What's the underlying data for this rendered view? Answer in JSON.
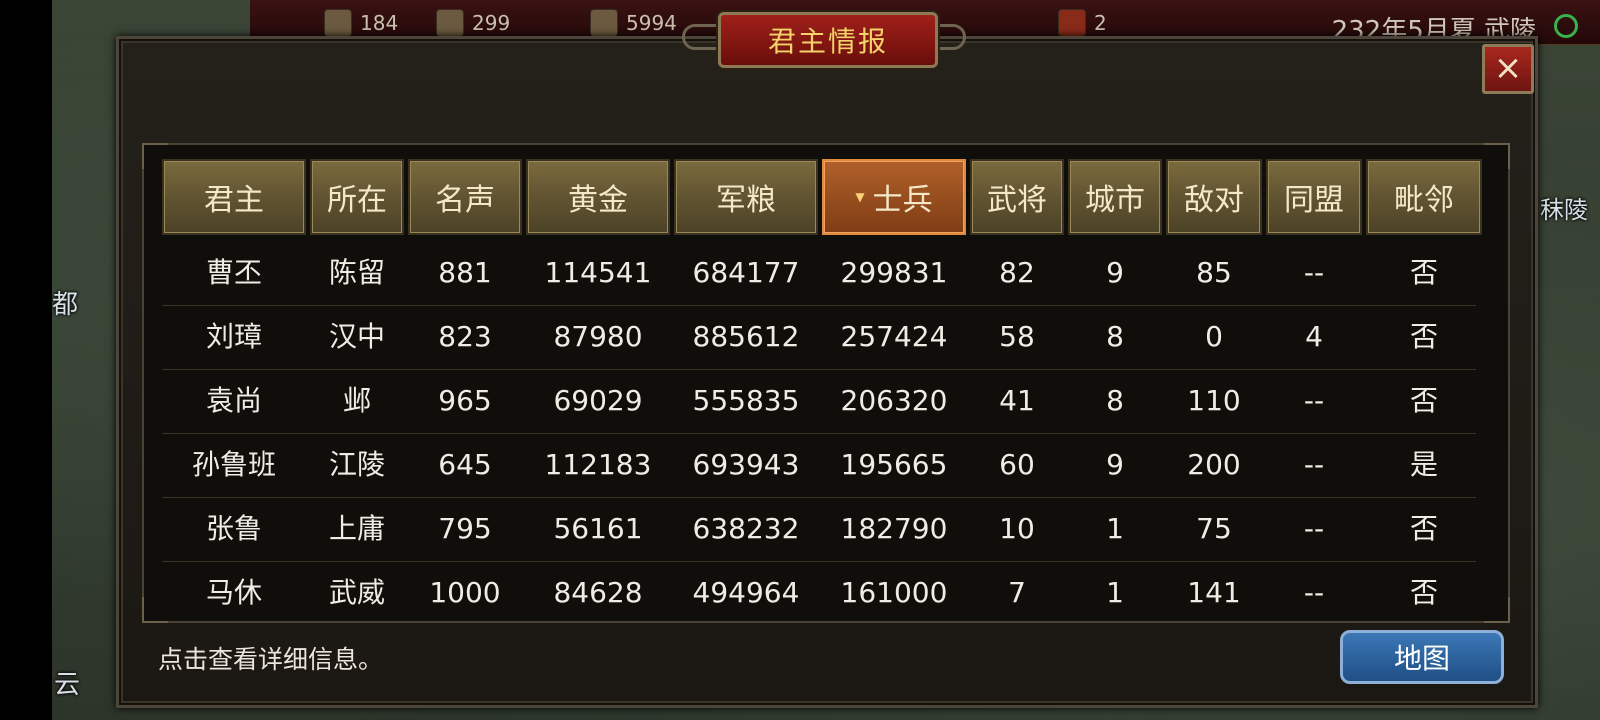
{
  "top_bar": {
    "resources": [
      "184",
      "299",
      "5994"
    ],
    "badge_count": "2",
    "date_location": "232年5月夏 武陵"
  },
  "map_labels": [
    "都",
    "秣陵",
    "云"
  ],
  "panel": {
    "title": "君主情报",
    "close_label": "×",
    "hint": "点击查看详细信息。",
    "map_button": "地图"
  },
  "table": {
    "columns": [
      "君主",
      "所在",
      "名声",
      "黄金",
      "军粮",
      "士兵",
      "武将",
      "城市",
      "敌对",
      "同盟",
      "毗邻"
    ],
    "sorted_column": "士兵",
    "rows": [
      [
        "曹丕",
        "陈留",
        "881",
        "114541",
        "684177",
        "299831",
        "82",
        "9",
        "85",
        "--",
        "否"
      ],
      [
        "刘璋",
        "汉中",
        "823",
        "87980",
        "885612",
        "257424",
        "58",
        "8",
        "0",
        "4",
        "否"
      ],
      [
        "袁尚",
        "邺",
        "965",
        "69029",
        "555835",
        "206320",
        "41",
        "8",
        "110",
        "--",
        "否"
      ],
      [
        "孙鲁班",
        "江陵",
        "645",
        "112183",
        "693943",
        "195665",
        "60",
        "9",
        "200",
        "--",
        "是"
      ],
      [
        "张鲁",
        "上庸",
        "795",
        "56161",
        "638232",
        "182790",
        "10",
        "1",
        "75",
        "--",
        "否"
      ],
      [
        "马休",
        "武威",
        "1000",
        "84628",
        "494964",
        "161000",
        "7",
        "1",
        "141",
        "--",
        "否"
      ]
    ]
  },
  "colors": {
    "header_gold": "#6c5d36",
    "header_active": "#a05322",
    "title_red": "#8a1a14",
    "map_button_blue": "#2c63a0"
  }
}
